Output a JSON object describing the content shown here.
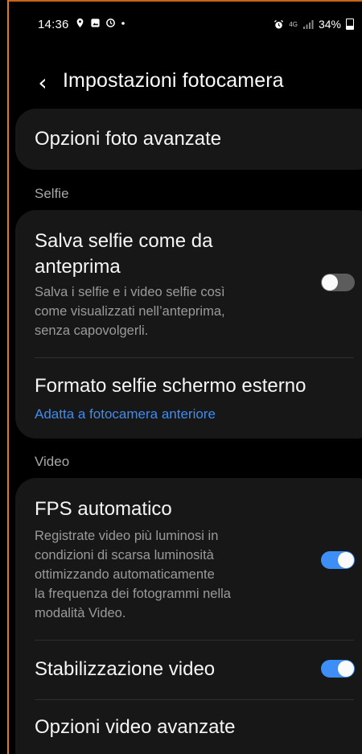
{
  "status_bar": {
    "time": "14:36",
    "network": "4G",
    "battery": "34%"
  },
  "header": {
    "title": "Impostazioni fotocamera"
  },
  "advanced_photo": {
    "label": "Opzioni foto avanzate"
  },
  "sections": {
    "selfie": "Selfie",
    "video": "Video"
  },
  "selfie_settings": {
    "save_as_preview": {
      "title_line1": "Salva selfie come da",
      "title_line2": "anteprima",
      "desc_line1": "Salva i selfie e i video selfie così",
      "desc_line2": "come visualizzati nell’anteprima,",
      "desc_line3": "senza capovolgerli.",
      "enabled": false
    },
    "cover_screen_format": {
      "title": "Formato selfie schermo esterno",
      "value": "Adatta a fotocamera anteriore"
    }
  },
  "video_settings": {
    "auto_fps": {
      "title": "FPS automatico",
      "desc_line1": "Registrate video più luminosi in",
      "desc_line2": "condizioni di scarsa luminosità",
      "desc_line3": "ottimizzando automaticamente",
      "desc_line4": "la frequenza dei fotogrammi nella",
      "desc_line5": "modalità Video.",
      "enabled": true
    },
    "stabilization": {
      "title": "Stabilizzazione video",
      "enabled": true
    },
    "advanced_video": {
      "label": "Opzioni video avanzate"
    }
  },
  "colors": {
    "accent": "#3e8ef7",
    "link": "#3f8cf0",
    "card": "#171717",
    "frame": "#e07b1c"
  }
}
